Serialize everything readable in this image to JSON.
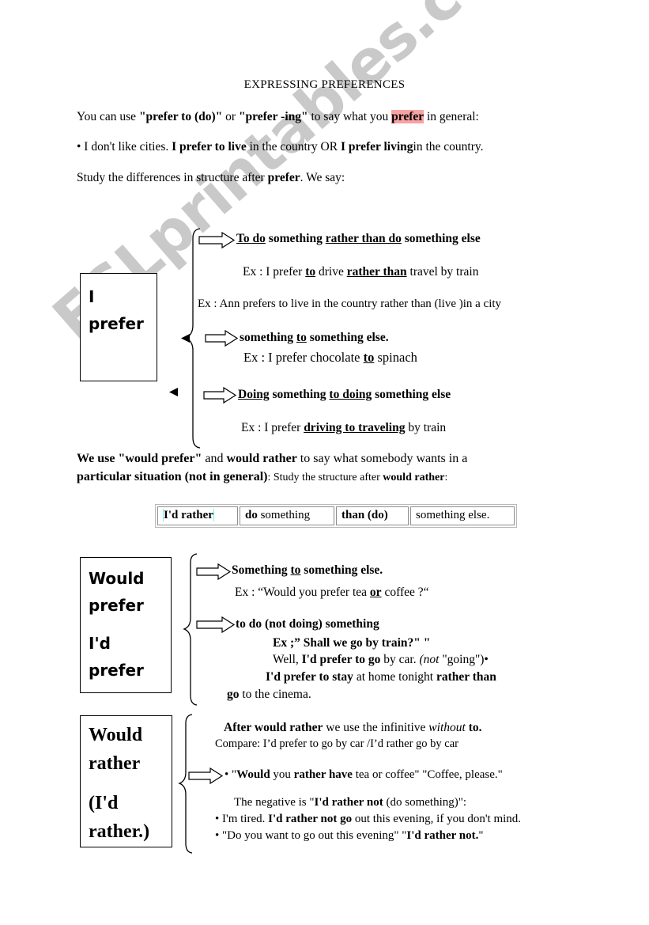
{
  "document": {
    "title": "EXPRESSING PREFERENCES",
    "watermark": "ESLprintables.com"
  },
  "colors": {
    "highlight_red": "#f9a2a2",
    "highlight_cyan": "#6ff5f1",
    "watermark_gray": "#c9c9c9",
    "ink": "#000000"
  },
  "intro": {
    "line1_a": "You can use ",
    "line1_b": "\"prefer to (do)\"",
    "line1_c": " or ",
    "line1_d": "\"prefer -ing\"",
    "line1_e": " to say what you ",
    "line1_f": "prefer",
    "line1_g": " in general:",
    "line2_a": "• I don't like cities. ",
    "line2_b": "I prefer to live",
    "line2_c": " in the country OR ",
    "line2_d": "I prefer living",
    "line2_e": "in the country.",
    "line3_a": "Study the differences in structure after ",
    "line3_b": "prefer",
    "line3_c": ". We say:"
  },
  "section_prefer": {
    "box": [
      "I",
      "prefer"
    ],
    "rows": [
      {
        "rule_a": "To do",
        "rule_b": " something ",
        "rule_c": "rather than do",
        "rule_d": " something else"
      },
      {
        "example_a": "Ex : I prefer ",
        "example_b": "to",
        "example_c": " drive ",
        "example_d": "rather than",
        "example_e": " travel by train"
      },
      {
        "example_full": "Ex : Ann prefers to live in the country rather than (live )in a city"
      },
      {
        "rule_a": "something ",
        "rule_b": "to",
        "rule_c": " something else."
      },
      {
        "example_a": "Ex : I prefer chocolate ",
        "example_b": "to",
        "example_c": " spinach"
      },
      {
        "rule_a": "Doing",
        "rule_b": " something ",
        "rule_c": "to doing",
        "rule_d": " something else"
      },
      {
        "example_a": "Ex : I prefer ",
        "example_b": "driving to traveling",
        "example_c": " by train"
      }
    ]
  },
  "bridge": {
    "line1_a": "We use ",
    "line1_b": "\"would prefer\"",
    "line1_c": " and ",
    "line1_d": "would rather",
    "line1_e": " to say what somebody wants in a",
    "line2_a": "particular situation (not in general)",
    "line2_b": ": Study the structure after ",
    "line2_c": "would rather",
    "line2_d": ":"
  },
  "structure_table": {
    "cells": [
      {
        "bold": "I'd rather",
        "rest": "",
        "highlight_word": "rather"
      },
      {
        "bold": "do",
        "rest": " something"
      },
      {
        "bold": "than (do)",
        "rest": ""
      },
      {
        "bold": "",
        "rest": "something else."
      }
    ]
  },
  "section_would_prefer": {
    "box": [
      "Would",
      "prefer",
      "I'd",
      "prefer"
    ],
    "rows": [
      {
        "rule_a": "Something ",
        "rule_b": "to",
        "rule_c": " something else."
      },
      {
        "example_a": "Ex : “Would you prefer tea ",
        "example_b": "or",
        "example_c": " coffee ?“"
      },
      {
        "rule_full": "to do (not doing) something"
      },
      {
        "example_full": "Ex ;” Shall we go by train?\" \""
      },
      {
        "example_a": "Well, ",
        "example_b": "I'd prefer to go",
        "example_c": " by car. ",
        "example_d": "(not",
        "example_e": " \"going\")•"
      },
      {
        "example_a": "I'd prefer to stay",
        "example_b": " at home tonight ",
        "example_c": "rather than"
      },
      {
        "example_a": "go",
        "example_b": " to the cinema."
      }
    ]
  },
  "section_would_rather": {
    "box": [
      "Would",
      "rather",
      "(I'd",
      "rather.)"
    ],
    "rows": [
      {
        "rule_a": "After ",
        "rule_b": "would rather",
        "rule_c": " we use the infinitive ",
        "rule_d": "without",
        "rule_e": " to."
      },
      {
        "example_full": "Compare:  I’d prefer to go by car /I’d rather go by car"
      },
      {
        "bullet": "•",
        "example_a": " \"",
        "example_b": "Would",
        "example_c": " you ",
        "example_d": "rather have",
        "example_e": " tea or coffee\" \"Coffee, please.\""
      },
      {
        "example_a": "The negative is \"",
        "example_b": "I'd rather not",
        "example_c": " (do something)\":"
      },
      {
        "bullet": "•",
        "example_a": " I'm tired. ",
        "example_b": "I'd rather not go",
        "example_c": " out this evening, if you don't mind."
      },
      {
        "bullet": "•",
        "example_a": " \"Do you want to go out this evening\" \"",
        "example_b": "I'd rather not.",
        "example_c": "\""
      }
    ]
  }
}
